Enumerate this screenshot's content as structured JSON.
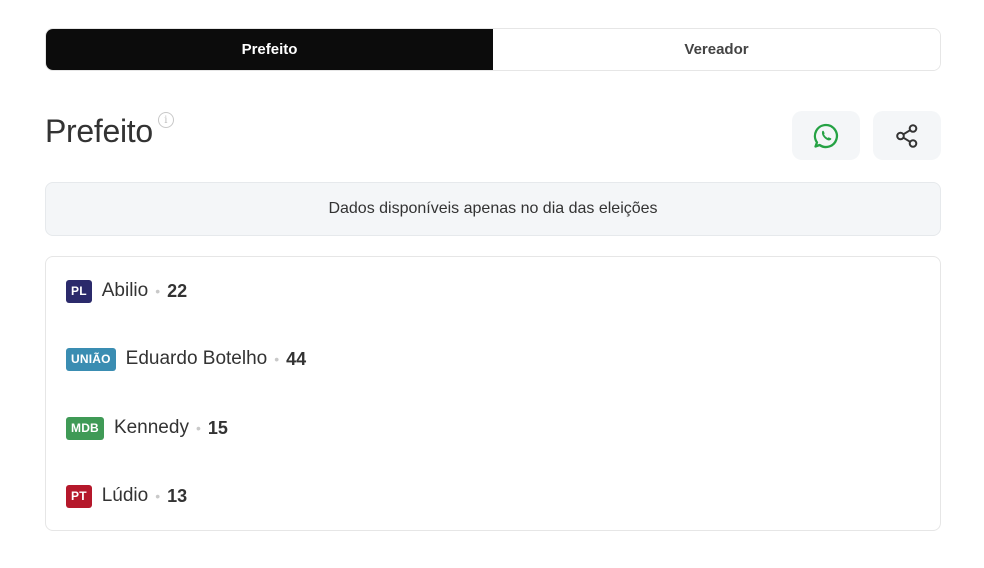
{
  "tabs": [
    {
      "label": "Prefeito",
      "active": true
    },
    {
      "label": "Vereador",
      "active": false
    }
  ],
  "header": {
    "title": "Prefeito",
    "info_icon": "ⓘ"
  },
  "actions": {
    "whatsapp_icon": "whatsapp-icon",
    "share_icon": "share-icon"
  },
  "notice": "Dados disponíveis apenas no dia das eleições",
  "candidates": [
    {
      "party": "PL",
      "party_color": "#2b2a6b",
      "name": "Abilio",
      "separator": "•",
      "number": "22"
    },
    {
      "party": "UNIÃO",
      "party_color": "#3a8db2",
      "name": "Eduardo Botelho",
      "separator": "•",
      "number": "44"
    },
    {
      "party": "MDB",
      "party_color": "#3f9a56",
      "name": "Kennedy",
      "separator": "•",
      "number": "15"
    },
    {
      "party": "PT",
      "party_color": "#b5182b",
      "name": "Lúdio",
      "separator": "•",
      "number": "13"
    }
  ],
  "colors": {
    "active_tab": "#0c0c0c",
    "whatsapp": "#25a244",
    "panel_bg": "#f4f6f8"
  }
}
